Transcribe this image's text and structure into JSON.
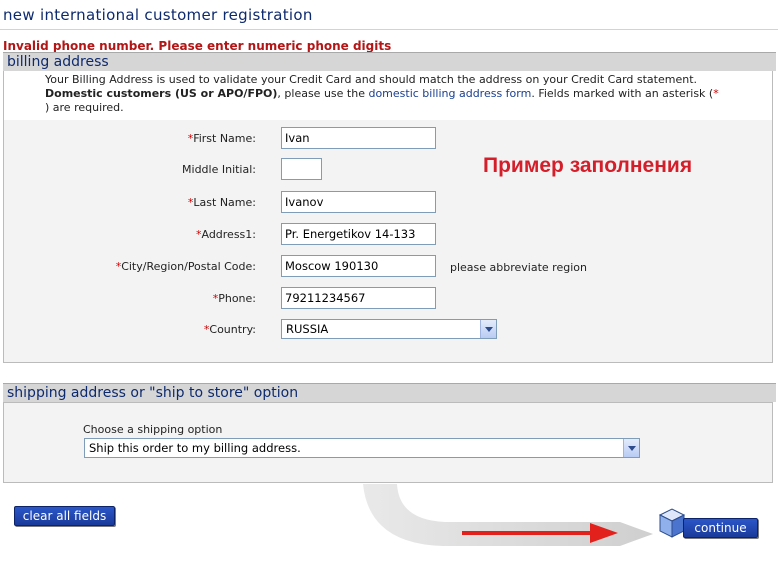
{
  "header": {
    "title": "new international customer registration"
  },
  "error": "Invalid phone number. Please enter numeric phone digits",
  "billing": {
    "heading": "billing address",
    "intro_line1": "Your Billing Address is used to validate your Credit Card and should match the address on your Credit Card statement.",
    "intro_bold": "Domestic customers (US or APO/FPO)",
    "intro_mid": ", please use the ",
    "intro_link": "domestic billing address form",
    "intro_after_link": ". Fields marked with an asterisk (",
    "intro_star": "*",
    "intro_end": ") are required.",
    "required_marker": "*",
    "fields": {
      "first_name": {
        "label": "First Name:",
        "value": "Ivan"
      },
      "middle_initial": {
        "label": "Middle Initial:",
        "value": ""
      },
      "last_name": {
        "label": "Last Name:",
        "value": "Ivanov"
      },
      "address1": {
        "label": "Address1:",
        "value": "Pr. Energetikov 14-133"
      },
      "city": {
        "label": "City/Region/Postal Code:",
        "value": "Moscow 190130",
        "hint": "please abbreviate region"
      },
      "phone": {
        "label": "Phone:",
        "value": "79211234567"
      },
      "country": {
        "label": "Country:",
        "value": "RUSSIA"
      }
    }
  },
  "annotation": "Пример заполнения",
  "shipping": {
    "heading": "shipping address or \"ship to store\" option",
    "choose_label": "Choose a shipping option",
    "selected_option": "Ship this order to my billing address."
  },
  "buttons": {
    "clear": "clear all fields",
    "continue": "continue"
  },
  "colors": {
    "accent": "#0e2a6e",
    "error": "#b31616",
    "annotation": "#d41f2b",
    "button": "#1f45b0"
  },
  "icons": {
    "continue_icon": "box-package-icon",
    "arrow": "red-arrow-icon",
    "swoosh": "grey-curved-arrow-icon"
  }
}
